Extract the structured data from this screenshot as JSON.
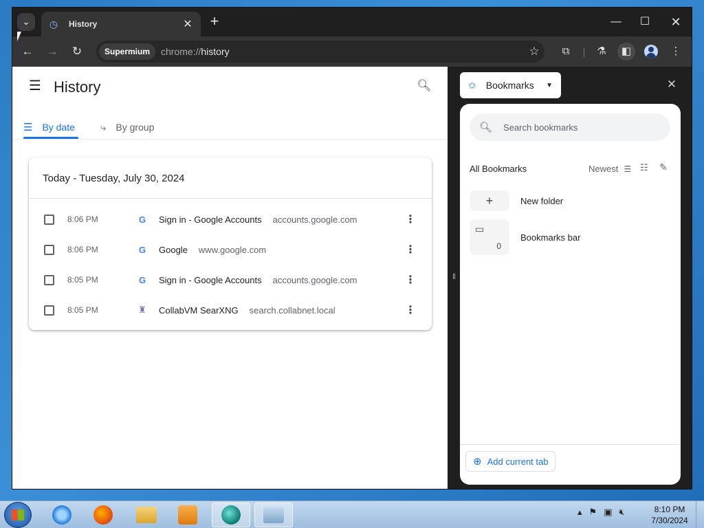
{
  "browser": {
    "tab": {
      "title": "History",
      "favicon": "history-icon"
    },
    "omnibox": {
      "chip": "Supermium",
      "url_scheme": "chrome://",
      "url_path": "history"
    }
  },
  "history": {
    "title": "History",
    "tabs": [
      {
        "label": "By date",
        "icon": "list-icon",
        "selected": true
      },
      {
        "label": "By group",
        "icon": "group-icon",
        "selected": false
      }
    ],
    "card_title": "Today - Tuesday, July 30, 2024",
    "rows": [
      {
        "time": "8:06 PM",
        "favicon": "G",
        "title": "Sign in - Google Accounts",
        "domain": "accounts.google.com"
      },
      {
        "time": "8:06 PM",
        "favicon": "G",
        "title": "Google",
        "domain": "www.google.com"
      },
      {
        "time": "8:05 PM",
        "favicon": "G",
        "title": "Sign in - Google Accounts",
        "domain": "accounts.google.com"
      },
      {
        "time": "8:05 PM",
        "favicon": "collabvm",
        "title": "CollabVM SearXNG",
        "domain": "search.collabnet.local"
      }
    ]
  },
  "sidepanel": {
    "dropdown_label": "Bookmarks",
    "search_placeholder": "Search bookmarks",
    "all_bookmarks": "All Bookmarks",
    "sort_label": "Newest",
    "new_folder": "New folder",
    "bookmarks_bar": "Bookmarks bar",
    "bookmarks_bar_count": "0",
    "add_current_tab": "Add current tab"
  },
  "taskbar": {
    "time": "8:10 PM",
    "date": "7/30/2024"
  },
  "colors": {
    "accent": "#1a73e8",
    "browser_frame": "#1f1f1f",
    "toolbar": "#353535"
  }
}
